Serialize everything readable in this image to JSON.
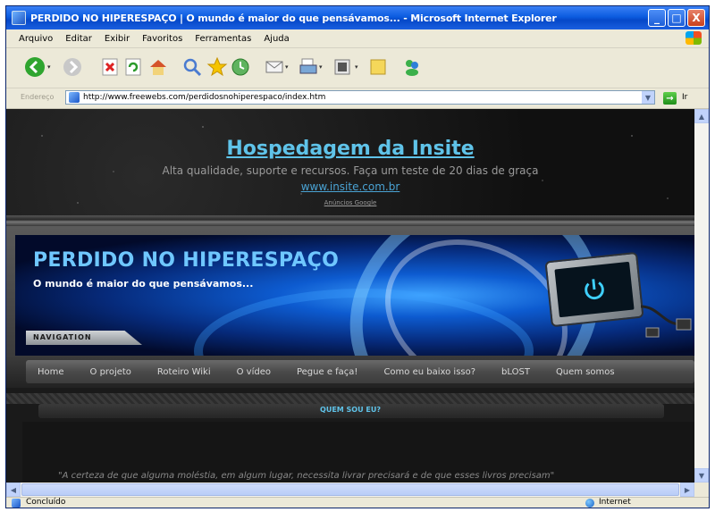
{
  "window": {
    "title": "PERDIDO NO HIPERESPAÇO | O mundo é maior do que pensávamos... - Microsoft Internet Explorer",
    "minimize_glyph": "_",
    "maximize_glyph": "□",
    "close_glyph": "X"
  },
  "menu": [
    "Arquivo",
    "Editar",
    "Exibir",
    "Favoritos",
    "Ferramentas",
    "Ajuda"
  ],
  "toolbar": {
    "buttons": [
      "back-icon",
      "forward-icon",
      "stop-icon",
      "refresh-icon",
      "home-icon",
      "search-icon",
      "favorites-icon",
      "history-icon",
      "mail-icon",
      "print-icon",
      "edit-icon",
      "discuss-icon",
      "messenger-icon",
      "folder-icon"
    ]
  },
  "address": {
    "label": "Endereço",
    "url": "http://www.freewebs.com/perdidosnohiperespaco/index.htm",
    "go_label": "Ir"
  },
  "ad": {
    "title": "Hospedagem da Insite",
    "subtitle": "Alta qualidade, suporte e recursos. Faça um teste de 20 dias de graça",
    "link": "www.insite.com.br",
    "attribution": "Anúncios Google"
  },
  "site": {
    "title": "PERDIDO NO HIPERESPAÇO",
    "tagline": "O mundo é maior do que pensávamos...",
    "nav_tab": "NAVIGATION",
    "nav_links": [
      "Home",
      "O projeto",
      "Roteiro Wiki",
      "O vídeo",
      "Pegue e faça!",
      "Como eu baixo isso?",
      "bLOST",
      "Quem somos"
    ]
  },
  "section": {
    "title": "QUEM SOU EU?",
    "text": "\"A certeza de que alguma moléstia, em algum lugar, necessita livrar precisará e de que esses livros precisam\""
  },
  "status": {
    "text": "Concluído",
    "zone": "Internet"
  }
}
